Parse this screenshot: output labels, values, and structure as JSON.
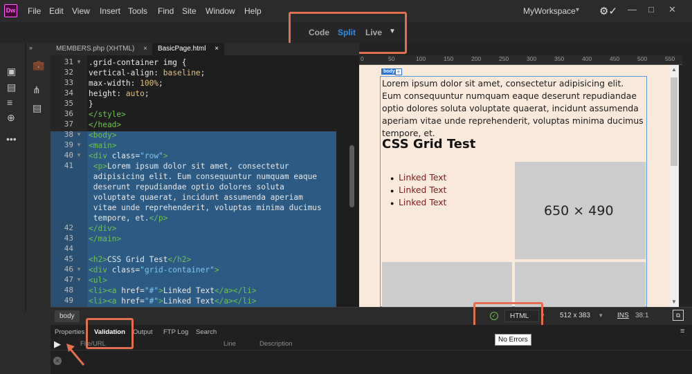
{
  "app": {
    "logo": "Dw",
    "menu": [
      "File",
      "Edit",
      "View",
      "Insert",
      "Tools",
      "Find",
      "Site",
      "Window",
      "Help"
    ],
    "workspace": "MyWorkspace"
  },
  "view_switcher": {
    "code": "Code",
    "split": "Split",
    "live": "Live"
  },
  "tabs": [
    {
      "label": "MEMBERS.php (XHTML)"
    },
    {
      "label": "BasicPage.html"
    }
  ],
  "close_glyph": "×",
  "editor": {
    "lines": [
      {
        "num": "31",
        "fold": "▼",
        "html": ".grid-container img {"
      },
      {
        "num": "32",
        "fold": "",
        "html": "vertical-align: baseline;"
      },
      {
        "num": "33",
        "fold": "",
        "html": "max-width: 100%;"
      },
      {
        "num": "34",
        "fold": "",
        "html": "height: auto;"
      },
      {
        "num": "35",
        "fold": "",
        "html": "}"
      },
      {
        "num": "36",
        "fold": "",
        "html": "</style>"
      },
      {
        "num": "37",
        "fold": "",
        "html": "</head>"
      },
      {
        "num": "38",
        "fold": "▼",
        "html": "<body>"
      },
      {
        "num": "39",
        "fold": "▼",
        "html": "<main>"
      },
      {
        "num": "40",
        "fold": "▼",
        "html": "<div class=\"row\">"
      },
      {
        "num": "41",
        "fold": "",
        "html": " <p>Lorem ipsum dolor sit amet, consectetur"
      },
      {
        "num": "",
        "fold": "",
        "html": " adipisicing elit. Eum consequuntur numquam eaque"
      },
      {
        "num": "",
        "fold": "",
        "html": " deserunt repudiandae optio dolores soluta"
      },
      {
        "num": "",
        "fold": "",
        "html": " voluptate quaerat, incidunt assumenda aperiam"
      },
      {
        "num": "",
        "fold": "",
        "html": " vitae unde reprehenderit, voluptas minima ducimus"
      },
      {
        "num": "",
        "fold": "",
        "html": " tempore, et.</p>"
      },
      {
        "num": "42",
        "fold": "",
        "html": "</div>"
      },
      {
        "num": "43",
        "fold": "",
        "html": "</main>"
      },
      {
        "num": "44",
        "fold": "",
        "html": ""
      },
      {
        "num": "45",
        "fold": "",
        "html": "<h2>CSS Grid Test</h2>"
      },
      {
        "num": "46",
        "fold": "▼",
        "html": "<div class=\"grid-container\">"
      },
      {
        "num": "47",
        "fold": "▼",
        "html": "<ul>"
      },
      {
        "num": "48",
        "fold": "",
        "html": "<li><a href=\"#\">Linked Text</a></li>"
      },
      {
        "num": "49",
        "fold": "",
        "html": "<li><a href=\"#\">Linked Text</a></li>"
      }
    ]
  },
  "ruler": [
    "0",
    "50",
    "100",
    "150",
    "200",
    "250",
    "300",
    "350",
    "400",
    "450",
    "500",
    "550"
  ],
  "preview": {
    "body_tag": "body",
    "body_plus": "+",
    "paragraph": "Lorem ipsum dolor sit amet, consectetur adipisicing elit. Eum consequuntur numquam eaque deserunt repudiandae optio dolores soluta voluptate quaerat, incidunt assumenda aperiam vitae unde reprehenderit, voluptas minima ducimus tempore, et.",
    "heading": "CSS Grid Test",
    "links": [
      "Linked Text",
      "Linked Text",
      "Linked Text"
    ],
    "image_label": "650 × 490"
  },
  "status": {
    "breadcrumb": "body",
    "doc_type": "HTML",
    "window_size": "512 x 383",
    "ins": "INS",
    "position": "38:1",
    "tooltip": "No Errors"
  },
  "panel": {
    "tabs": [
      "Properties",
      "Validation",
      "Output",
      "FTP Log",
      "Search"
    ],
    "active_tab": "Validation",
    "columns": [
      "File/URL",
      "Line",
      "Description"
    ]
  },
  "colors": {
    "accent": "#2d8ceb",
    "callout": "#e0704f",
    "code_selection": "#2c5a83",
    "preview_bg": "#faeadb"
  }
}
